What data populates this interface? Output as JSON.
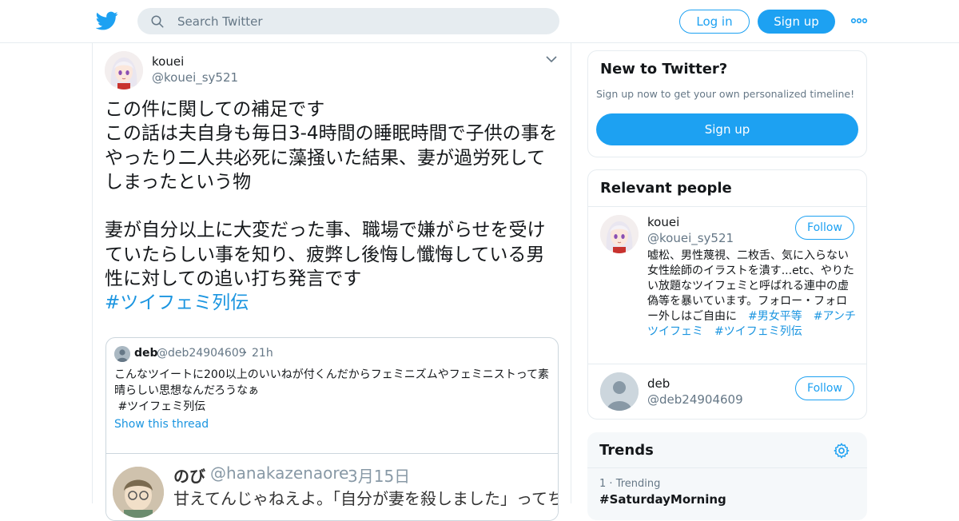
{
  "header": {
    "search_placeholder": "Search Twitter",
    "login_label": "Log in",
    "signup_label": "Sign up"
  },
  "tweet": {
    "name": "kouei",
    "handle": "@kouei_sy521",
    "body": "この件に関しての補足です\nこの話は夫自身も毎日3-4時間の睡眠時間で子供の事をやったり二人共必死に藻掻いた結果、妻が過労死してしまったという物\n\n妻が自分以上に大変だった事、職場で嫌がらせを受けていたらしい事を知り、疲弊し後悔し懺悔している男性に対しての追い打ち発言です",
    "hashtag": "#ツイフェミ列伝",
    "quote": {
      "name": "deb",
      "handle": "@deb24904609",
      "separator": "·",
      "time": "21h",
      "text": "こんなツイートに200以上のいいねが付くんだからフェミニズムやフェミニストって素晴らしい思想なんだろうなぁ\n #ツイフェミ列伝",
      "show_thread": "Show this thread",
      "image": {
        "name": "のび",
        "handle": "@hanakazenaore",
        "separator": "·",
        "date": "3月15日",
        "text": "甘えてんじゃねえよ。「自分が妻を殺しました」ってち"
      }
    }
  },
  "sidebar": {
    "new_to_twitter": {
      "title": "New to Twitter?",
      "subtitle": "Sign up now to get your own personalized timeline!",
      "button": "Sign up"
    },
    "relevant_people": {
      "title": "Relevant people",
      "follow_label": "Follow",
      "people": [
        {
          "name": "kouei",
          "handle": "@kouei_sy521",
          "bio": "嘘松、男性蔑視、二枚舌、気に入らない女性絵師のイラストを潰す...etc、やりたい放題なツイフェミと呼ばれる連中の虚偽等を暴いています。フォロー・フォロー外しはご自由に",
          "bio_tags": [
            "#男女平等",
            "#アンチツイフェミ",
            "#ツイフェミ列伝"
          ]
        },
        {
          "name": "deb",
          "handle": "@deb24904609"
        }
      ]
    },
    "trends": {
      "title": "Trends",
      "items": [
        {
          "rank": "1",
          "separator": "·",
          "label": "Trending",
          "name": "#SaturdayMorning"
        }
      ]
    }
  },
  "colors": {
    "accent": "#1da1f2",
    "link": "#1b95e0",
    "muted": "#657786",
    "border": "#e6ecf0"
  },
  "icons": [
    "twitter-bird-icon",
    "search-icon",
    "more-dots-icon",
    "chevron-down-icon",
    "settings-gear-icon"
  ]
}
